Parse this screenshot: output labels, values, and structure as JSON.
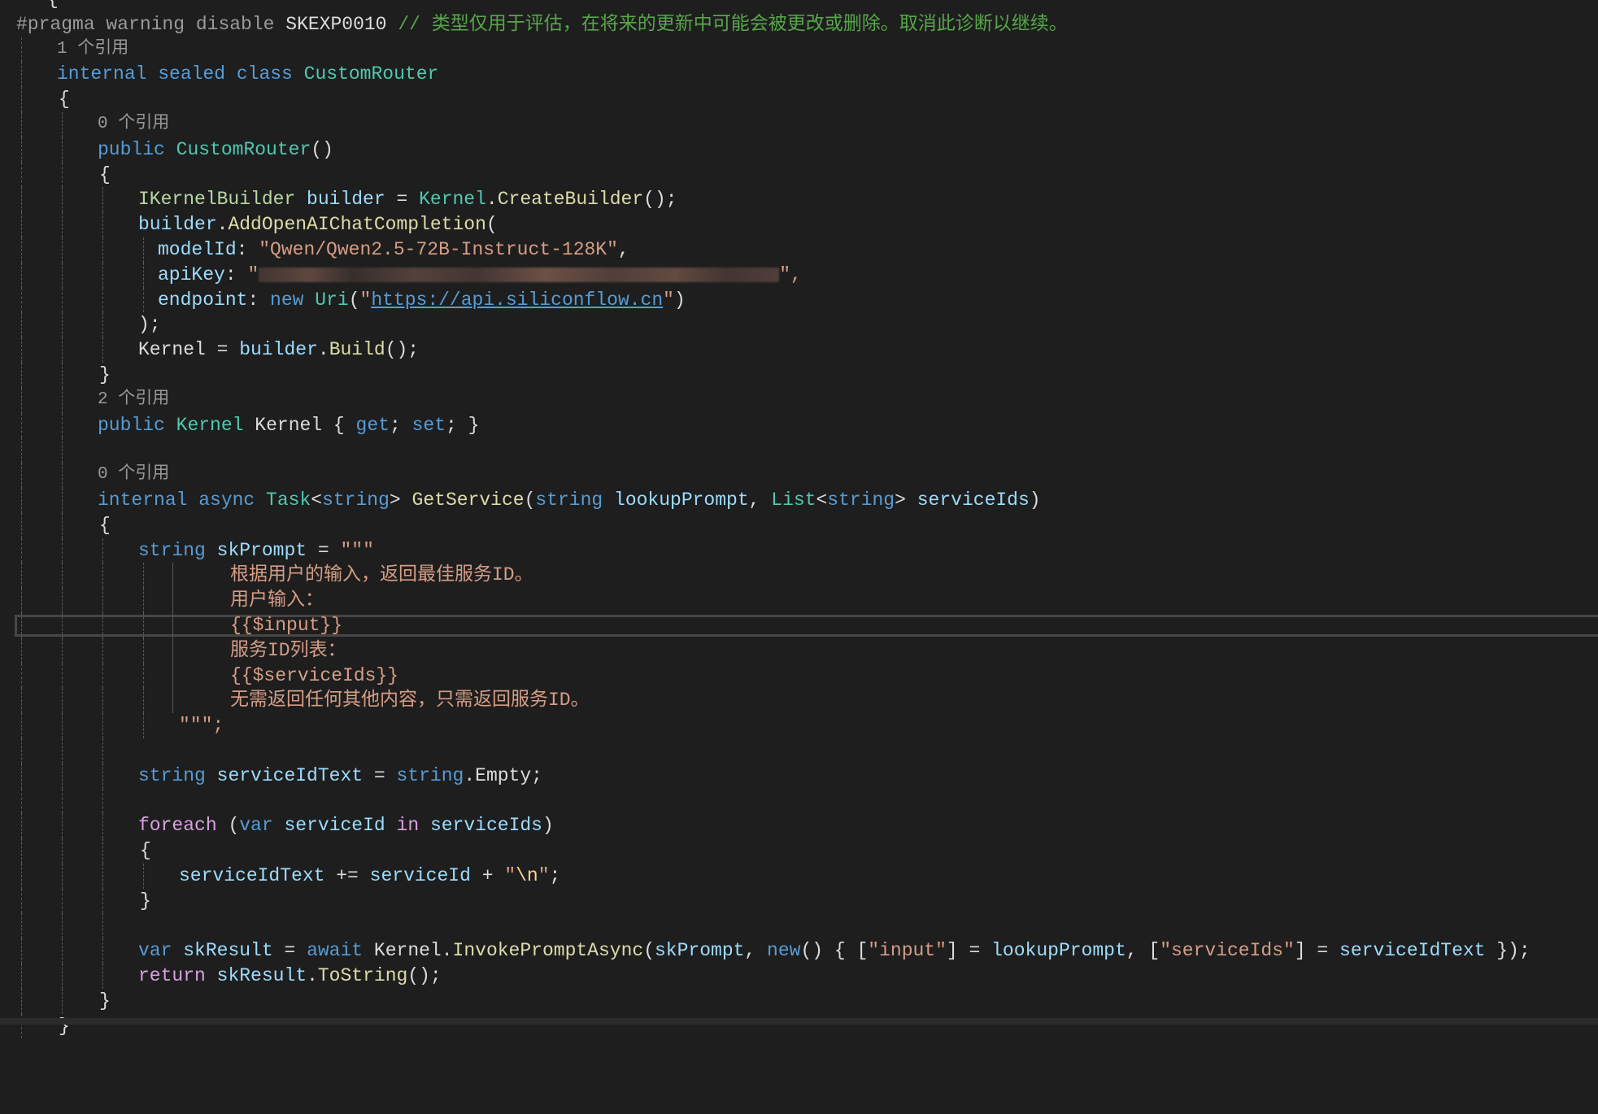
{
  "editor": {
    "language": "C#",
    "theme": "dark",
    "lines": {
      "open_brace_top": "{",
      "pragma_directive": "#pragma warning disable",
      "pragma_code": "SKEXP0010",
      "pragma_comment": "// 类型仅用于评估，在将来的更新中可能会被更改或删除。取消此诊断以继续。",
      "codelens_class": "1 个引用",
      "class_kw": "internal sealed class",
      "class_name": "CustomRouter",
      "open_brace": "{",
      "close_brace": "}",
      "codelens_ctor": "0 个引用",
      "ctor_kw": "public",
      "ctor_name": "CustomRouter",
      "parens": "()",
      "builder_type": "IKernelBuilder",
      "builder_var": "builder",
      "eq": " = ",
      "kernel_type": "Kernel",
      "create_builder": "CreateBuilder",
      "call_end": "();",
      "add_chat": "AddOpenAIChatCompletion",
      "open_paren": "(",
      "model_label": "modelId",
      "model_value": "\"Qwen/Qwen2.5-72B-Instruct-128K\"",
      "apikey_label": "apiKey",
      "apikey_open": "\"",
      "apikey_close": "\",",
      "endpoint_label": "endpoint",
      "new_kw": "new",
      "uri_type": "Uri",
      "endpoint_url": "https://api.siliconflow.cn",
      "close_call": ");",
      "kernel_prop": "Kernel",
      "build": "Build",
      "codelens_prop": "2 个引用",
      "prop_kw": "public",
      "prop_accessors_get": "get",
      "prop_accessors_set": "set",
      "codelens_method": "0 个引用",
      "method_mods": "internal async",
      "task_type": "Task",
      "string_kw": "string",
      "method_name": "GetService",
      "param1": "lookupPrompt",
      "list_type": "List",
      "param2": "serviceIds",
      "skprompt_var": "skPrompt",
      "raw_open": "\"\"\"",
      "raw_close": "\"\"\";",
      "prompt_line1": "根据用户的输入，返回最佳服务ID。",
      "prompt_line2": "用户输入：",
      "prompt_line3": "{{$input}}",
      "prompt_line4": "服务ID列表：",
      "prompt_line5": "{{$serviceIds}}",
      "prompt_line6": "无需返回任何其他内容，只需返回服务ID。",
      "service_text_var": "serviceIdText",
      "empty": "Empty",
      "foreach_kw": "foreach",
      "var_kw": "var",
      "service_id_var": "serviceId",
      "in_kw": "in",
      "plus_eq": " += ",
      "plus": " + ",
      "newline_escape": "\\n",
      "skresult_var": "skResult",
      "await_kw": "await",
      "invoke": "InvokePromptAsync",
      "key_input": "\"input\"",
      "key_service_ids": "\"serviceIds\"",
      "return_kw": "return",
      "to_string": "ToString"
    }
  }
}
